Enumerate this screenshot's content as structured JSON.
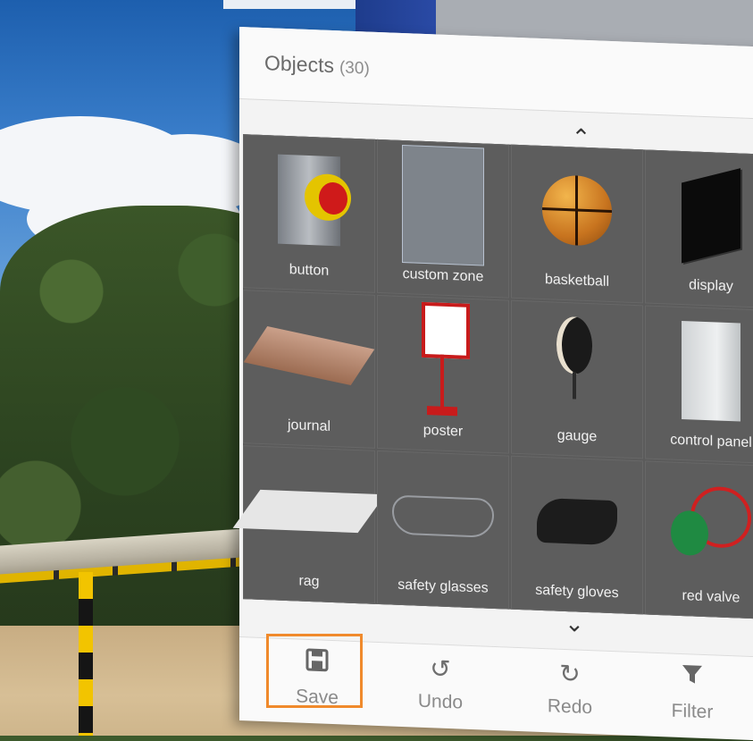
{
  "panel": {
    "title": "Objects",
    "count": "(30)",
    "scroll_up_icon": "chevron-up-icon",
    "scroll_down_icon": "chevron-down-icon"
  },
  "objects": [
    {
      "label": "button",
      "icon": "emergency-button-icon"
    },
    {
      "label": "custom zone",
      "icon": "custom-zone-icon"
    },
    {
      "label": "basketball",
      "icon": "basketball-icon"
    },
    {
      "label": "display",
      "icon": "display-icon"
    },
    {
      "label": "journal",
      "icon": "journal-icon"
    },
    {
      "label": "poster",
      "icon": "poster-icon"
    },
    {
      "label": "gauge",
      "icon": "gauge-icon"
    },
    {
      "label": "control panel",
      "icon": "control-panel-icon"
    },
    {
      "label": "rag",
      "icon": "rag-icon"
    },
    {
      "label": "safety glasses",
      "icon": "safety-glasses-icon"
    },
    {
      "label": "safety gloves",
      "icon": "safety-gloves-icon"
    },
    {
      "label": "red valve",
      "icon": "red-valve-icon"
    }
  ],
  "toolbar": {
    "save_label": "Save",
    "undo_label": "Undo",
    "redo_label": "Redo",
    "filter_label": "Filter"
  },
  "colors": {
    "highlight": "#f08a2c",
    "panel_bg": "#f3f3f3",
    "grid_bg": "#5b5b5b"
  }
}
